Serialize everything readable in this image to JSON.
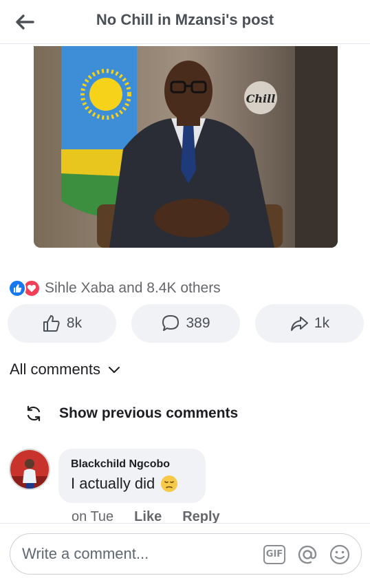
{
  "header": {
    "title": "No Chill in Mzansi's post"
  },
  "post": {
    "watermark": "Chill"
  },
  "reactions": {
    "summary": "Sihle Xaba and 8.4K others"
  },
  "actions": {
    "like_count": "8k",
    "comment_count": "389",
    "share_count": "1k"
  },
  "comments": {
    "filter_label": "All comments",
    "show_previous_label": "Show previous comments",
    "items": [
      {
        "author": "Blackchild Ngcobo",
        "text": "I actually did",
        "time": "on Tue",
        "like_label": "Like",
        "reply_label": "Reply"
      }
    ]
  },
  "composer": {
    "placeholder": "Write a comment...",
    "gif_label": "GIF"
  },
  "colors": {
    "like_blue": "#1877f2",
    "love_red": "#f33e58",
    "button_bg": "#f0f2f5",
    "text_muted": "#65676b"
  }
}
